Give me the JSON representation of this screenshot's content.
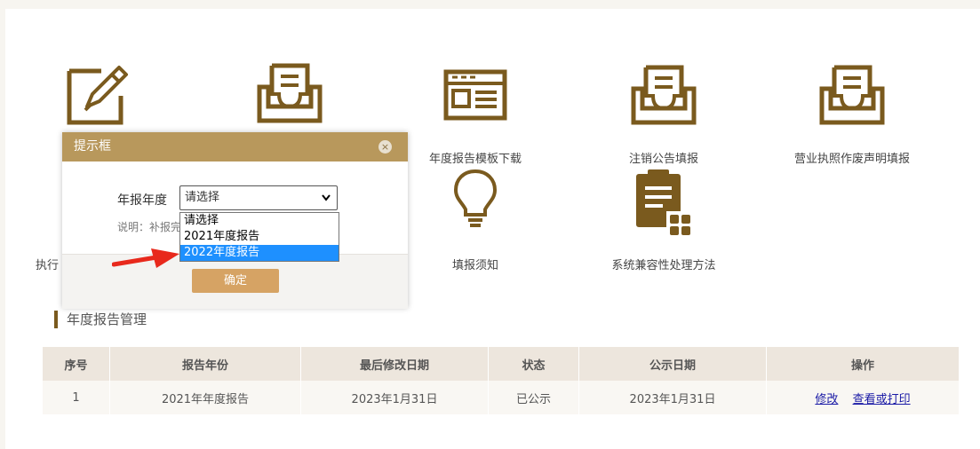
{
  "tiles": [
    {
      "icon": "edit-icon",
      "label": "",
      "label_visible": ""
    },
    {
      "icon": "inbox-doc-icon",
      "label": ""
    },
    {
      "icon": "template-doc-icon",
      "label": "年度报告模板下载"
    },
    {
      "icon": "inbox-doc-icon",
      "label": "注销公告填报"
    },
    {
      "icon": "inbox-doc-icon",
      "label": "营业执照作废声明填报"
    },
    {
      "icon": "lightbulb-icon",
      "label": "填报须知"
    },
    {
      "icon": "clipboard-grid-icon",
      "label": "系统兼容性处理方法"
    }
  ],
  "partial_labels": {
    "left_tile_fragment": "执行",
    "row1_fragment": "年"
  },
  "section": {
    "title": "年度报告管理"
  },
  "table": {
    "headers": [
      "序号",
      "报告年份",
      "最后修改日期",
      "状态",
      "公示日期",
      "操作"
    ],
    "rows": [
      {
        "index": "1",
        "year": "2021年年度报告",
        "modified": "2023年1月31日",
        "status": "已公示",
        "published": "2023年1月31日",
        "action_edit": "修改",
        "action_view": "查看或打印"
      }
    ]
  },
  "dialog": {
    "title": "提示框",
    "close_glyph": "×",
    "field_label": "年报年度",
    "note": "说明：补报完",
    "confirm_label": "确定",
    "select": {
      "selected": "请选择",
      "options": [
        "请选择",
        "2021年度报告",
        "2022年度报告"
      ],
      "highlighted": "2022年度报告"
    }
  },
  "colors": {
    "brand": "#7a5a1e",
    "dialog_header": "#b8985c",
    "confirm_button": "#d6a364",
    "highlight": "#1e90ff",
    "annotation_arrow": "#e8291c"
  }
}
